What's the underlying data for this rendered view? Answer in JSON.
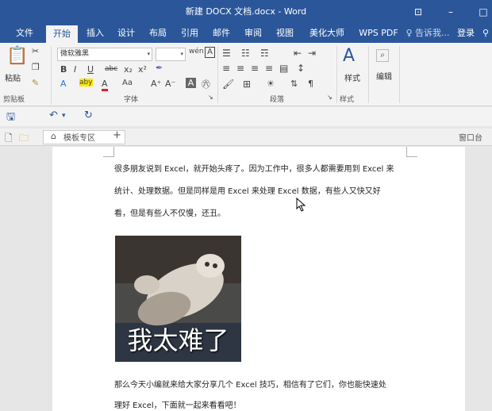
{
  "window": {
    "title": "新建 DOCX 文档.docx - Word",
    "controls": [
      "⊡",
      "–",
      "□"
    ]
  },
  "tabs": [
    {
      "label": "文件"
    },
    {
      "label": "开始"
    },
    {
      "label": "插入"
    },
    {
      "label": "设计"
    },
    {
      "label": "布局"
    },
    {
      "label": "引用"
    },
    {
      "label": "邮件"
    },
    {
      "label": "审阅"
    },
    {
      "label": "视图"
    },
    {
      "label": "美化大师"
    },
    {
      "label": "WPS PDF"
    }
  ],
  "tell_me": "♀ 告诉我...",
  "login": "登录",
  "ribbon": {
    "clipboard": {
      "paste": "粘贴",
      "group": "剪贴板"
    },
    "font": {
      "name": "微软雅黑",
      "size": "",
      "group": "字体",
      "row1": [
        "B",
        "I",
        "U",
        "abc",
        "x₂",
        "x²"
      ],
      "row2": [
        "A",
        "aby",
        "A",
        "Aa",
        "A⁺",
        "A⁻",
        "A",
        "㊅"
      ]
    },
    "paragraph": {
      "group": "段落"
    },
    "styles": {
      "label": "样式",
      "group": "样式"
    },
    "editing": {
      "label": "编辑"
    }
  },
  "tabstrip": {
    "template_tab": "模板专区",
    "add": "+",
    "window_label": "窗口台"
  },
  "document": {
    "lines": [
      "很多朋友说到 Excel，就开始头疼了。因为工作中，很多人都需要用到 Excel 来",
      "统计、处理数据。但是同样是用 Excel 来处理 Excel 数据，有些人又快又好",
      "看，但是有些人不仅慢，还丑。"
    ],
    "image_caption": "我太难了",
    "lines_after": [
      "那么今天小编就来给大家分享几个 Excel 技巧，相信有了它们，你也能快速处",
      "理好 Excel，下面就一起来看看吧！"
    ]
  },
  "colors": {
    "accent": "#2b579a",
    "ribbon_bg": "#f3f3f3",
    "page_bg": "#ffffff",
    "canvas_bg": "#e6e6e6"
  }
}
